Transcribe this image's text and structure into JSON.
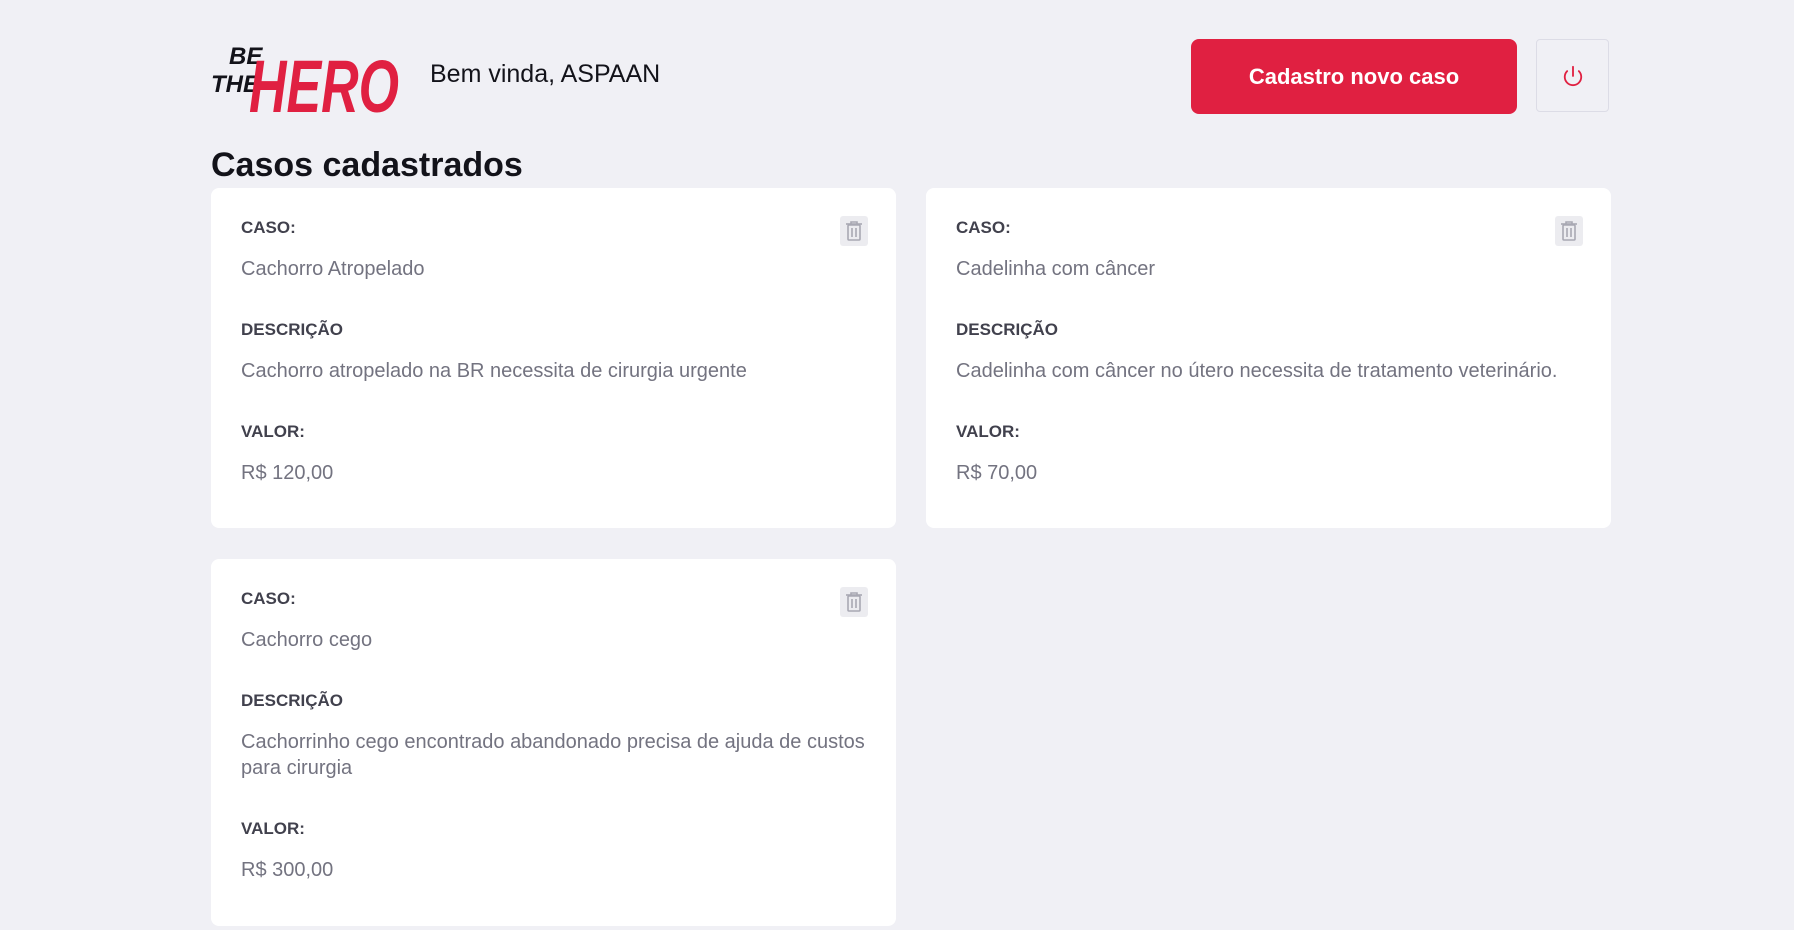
{
  "header": {
    "logo_line1": "BE",
    "logo_line2": "THE",
    "logo_word": "HERO",
    "welcome": "Bem vinda, ASPAAN",
    "new_case_label": "Cadastro novo caso",
    "logout_icon": "power-icon"
  },
  "page_title": "Casos cadastrados",
  "labels": {
    "case": "CASO:",
    "description": "DESCRIÇÃO",
    "value": "VALOR:"
  },
  "cases": [
    {
      "title": "Cachorro Atropelado",
      "description": "Cachorro atropelado na BR necessita de cirurgia urgente",
      "value": "R$ 120,00"
    },
    {
      "title": "Cadelinha com câncer",
      "description": "Cadelinha com câncer no útero necessita de tratamento veterinário.",
      "value": "R$ 70,00"
    },
    {
      "title": "Cachorro cego",
      "description": "Cachorrinho cego encontrado abandonado precisa de ajuda de custos para cirurgia",
      "value": "R$ 300,00"
    }
  ],
  "colors": {
    "brand": "#e02041",
    "background": "#f0f0f5",
    "card": "#ffffff",
    "label": "#41414d",
    "value": "#737380"
  }
}
